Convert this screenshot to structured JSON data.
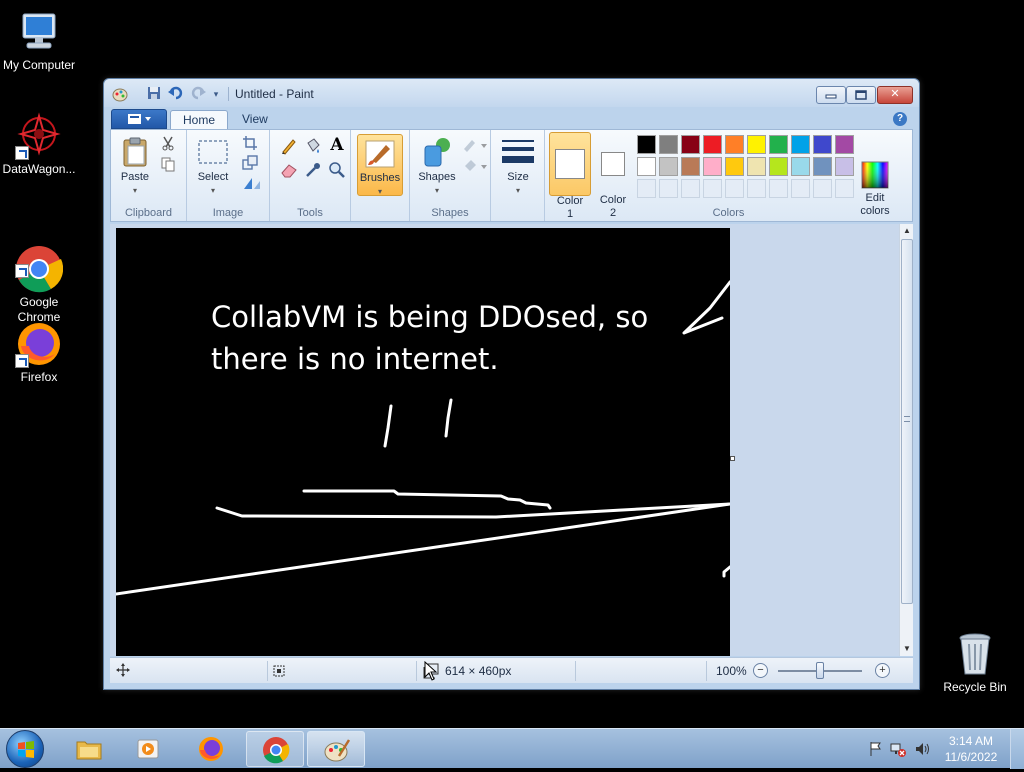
{
  "desktop": {
    "icons": [
      {
        "label": "My Computer"
      },
      {
        "label": "DataWagon..."
      },
      {
        "label": "Google\nChrome"
      },
      {
        "label": "Firefox"
      }
    ],
    "recycle_bin": {
      "label": "Recycle Bin"
    }
  },
  "window": {
    "title": "Untitled - Paint",
    "quick_access": [
      "save-icon",
      "undo-icon",
      "redo-icon",
      "customize-icon"
    ],
    "controls": {
      "minimize": "▭",
      "maximize": "□",
      "close": "✕"
    }
  },
  "ribbon": {
    "tabs": [
      {
        "label": "Home",
        "active": true
      },
      {
        "label": "View",
        "active": false
      }
    ],
    "help": "?",
    "groups": {
      "clipboard": {
        "label": "Clipboard",
        "paste": "Paste"
      },
      "image": {
        "label": "Image",
        "select": "Select"
      },
      "tools": {
        "label": "Tools"
      },
      "brushes": {
        "label": "Brushes"
      },
      "shapes": {
        "label": "Shapes",
        "shapes_button": "Shapes"
      },
      "size": {
        "label": "Size"
      },
      "colors": {
        "label": "Colors",
        "color1": "Color\n1",
        "color2": "Color\n2",
        "edit": "Edit\ncolors",
        "palette_row1": [
          "#000000",
          "#7f7f7f",
          "#880015",
          "#ed1c24",
          "#ff7f27",
          "#fff200",
          "#22b14c",
          "#00a2e8",
          "#3f48cc",
          "#a349a4"
        ],
        "palette_row2": [
          "#ffffff",
          "#c3c3c3",
          "#b97a57",
          "#ffaec9",
          "#ffc90e",
          "#efe4b0",
          "#b5e61d",
          "#99d9ea",
          "#7092be",
          "#c8bfe7"
        ],
        "selected_color1": "#ffffff",
        "selected_color2": "#ffffff"
      }
    }
  },
  "canvas": {
    "text_line1": "CollabVM is being DDOsed, so",
    "text_line2": "there is no internet.",
    "background": "#000000",
    "stroke_color": "#ffffff"
  },
  "statusbar": {
    "size": "614 × 460px",
    "zoom": "100%"
  },
  "taskbar": {
    "apps": [
      "windows-explorer",
      "media-player",
      "firefox",
      "chrome",
      "paint"
    ],
    "clock_time": "3:14 AM",
    "clock_date": "11/6/2022"
  }
}
